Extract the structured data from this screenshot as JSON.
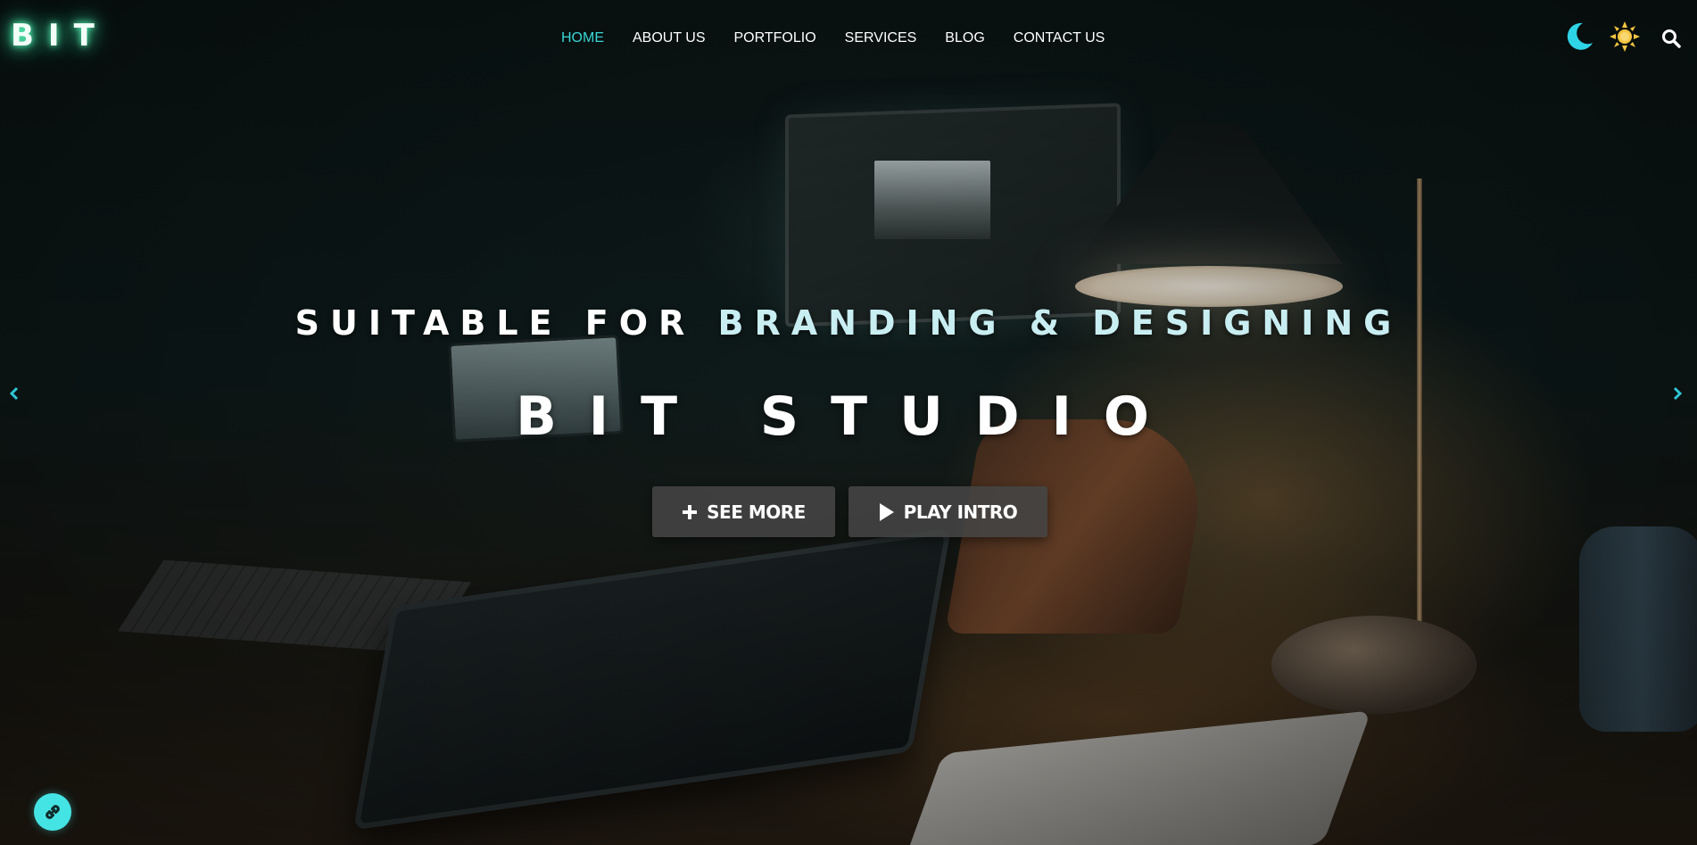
{
  "header": {
    "logo": "BIT",
    "nav": [
      {
        "label": "HOME",
        "active": true
      },
      {
        "label": "ABOUT US",
        "active": false
      },
      {
        "label": "PORTFOLIO",
        "active": false
      },
      {
        "label": "SERVICES",
        "active": false
      },
      {
        "label": "BLOG",
        "active": false
      },
      {
        "label": "CONTACT US",
        "active": false
      }
    ],
    "icons": [
      "moon-icon",
      "sun-icon",
      "search-icon"
    ]
  },
  "hero": {
    "subtitle_prefix": "SUITABLE FOR ",
    "subtitle_highlight": "BRANDING & DESIGNING",
    "title": "BIT STUDIO",
    "buttons": {
      "see_more": "SEE MORE",
      "play_intro": "PLAY INTRO"
    }
  },
  "colors": {
    "accent": "#3ad6d6",
    "moon": "#2ed3e6",
    "sun": "#f5c542",
    "button_bg": "#444444",
    "fab": "#45e4e4"
  }
}
